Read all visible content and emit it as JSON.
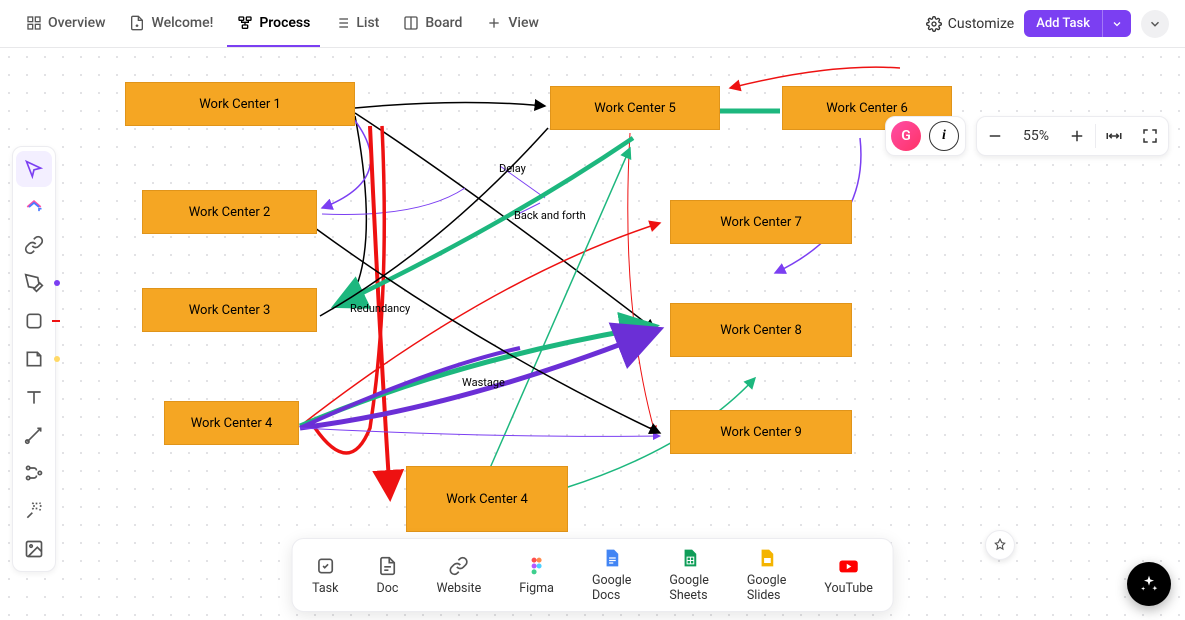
{
  "tabs": {
    "overview": "Overview",
    "welcome": "Welcome!",
    "process": "Process",
    "list": "List",
    "board": "Board",
    "view": "View"
  },
  "topbar": {
    "customize": "Customize",
    "addTask": "Add Task"
  },
  "user": {
    "initial": "G"
  },
  "info": {
    "letter": "i"
  },
  "zoom": "55%",
  "nodes": {
    "wc1": "Work Center 1",
    "wc2": "Work Center 2",
    "wc3": "Work Center 3",
    "wc4a": "Work Center 4",
    "wc4b": "Work Center 4",
    "wc5": "Work Center 5",
    "wc6": "Work Center 6",
    "wc7": "Work Center 7",
    "wc8": "Work Center 8",
    "wc9": "Work Center 9"
  },
  "labels": {
    "delay": "Delay",
    "backforth": "Back and forth",
    "redundancy": "Redundancy",
    "wastage": "Wastage"
  },
  "bottom": {
    "task": "Task",
    "doc": "Doc",
    "website": "Website",
    "figma": "Figma",
    "gdocs": "Google Docs",
    "gsheets": "Google Sheets",
    "gslides": "Google Slides",
    "youtube": "YouTube"
  }
}
